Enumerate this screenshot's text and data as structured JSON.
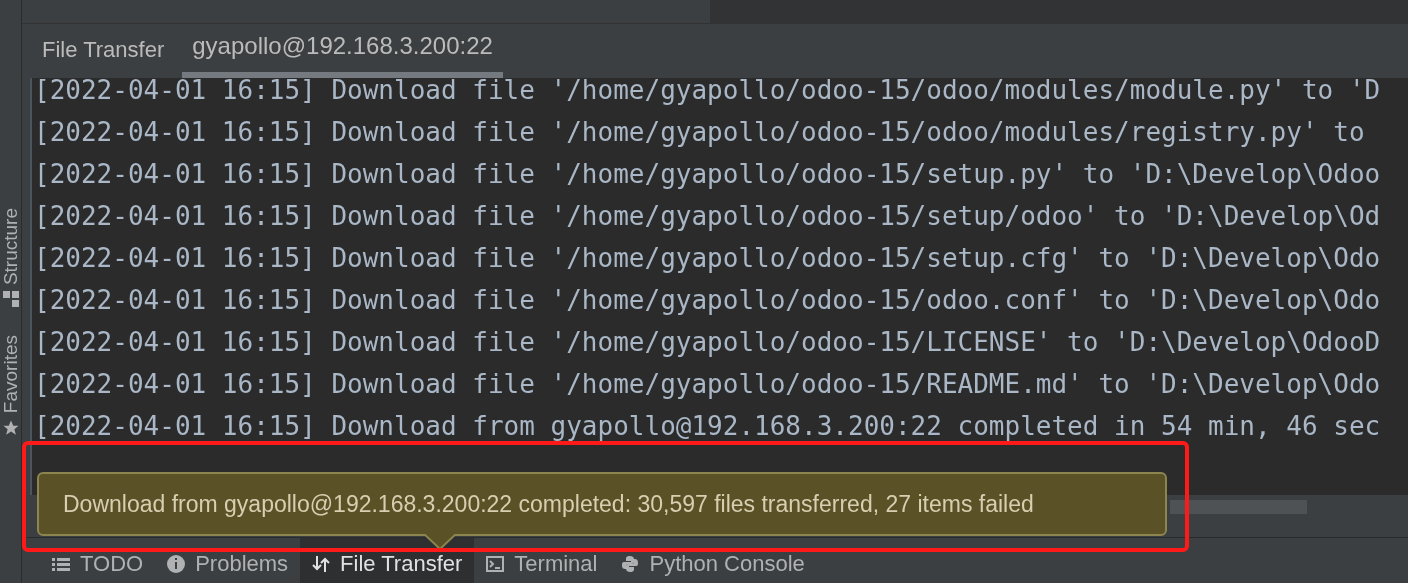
{
  "side_panels": [
    {
      "label": "Structure",
      "kind": "structure"
    },
    {
      "label": "Favorites",
      "kind": "favorites"
    }
  ],
  "tool_window": {
    "title": "File Transfer",
    "tabs": [
      {
        "label": "gyapollo@192.168.3.200:22",
        "selected": true
      }
    ]
  },
  "log_lines": [
    "[2022-04-01 16:15] Download file '/home/gyapollo/odoo-15/odoo/modules/module.py' to 'D",
    "[2022-04-01 16:15] Download file '/home/gyapollo/odoo-15/odoo/modules/registry.py' to",
    "[2022-04-01 16:15] Download file '/home/gyapollo/odoo-15/setup.py' to 'D:\\Develop\\Odoo",
    "[2022-04-01 16:15] Download file '/home/gyapollo/odoo-15/setup/odoo' to 'D:\\Develop\\Od",
    "[2022-04-01 16:15] Download file '/home/gyapollo/odoo-15/setup.cfg' to 'D:\\Develop\\Odo",
    "[2022-04-01 16:15] Download file '/home/gyapollo/odoo-15/odoo.conf' to 'D:\\Develop\\Odo",
    "[2022-04-01 16:15] Download file '/home/gyapollo/odoo-15/LICENSE' to 'D:\\Develop\\OdooD",
    "[2022-04-01 16:15] Download file '/home/gyapollo/odoo-15/README.md' to 'D:\\Develop\\Odo",
    "[2022-04-01 16:15] Download from gyapollo@192.168.3.200:22 completed in 54 min, 46 sec"
  ],
  "notification": {
    "text": "Download from gyapollo@192.168.3.200:22 completed: 30,597 files transferred, 27 items failed"
  },
  "bottom_tabs": [
    {
      "label": "TODO",
      "kind": "todo",
      "selected": false
    },
    {
      "label": "Problems",
      "kind": "problems",
      "selected": false
    },
    {
      "label": "File Transfer",
      "kind": "transfer",
      "selected": true
    },
    {
      "label": "Terminal",
      "kind": "terminal",
      "selected": false
    },
    {
      "label": "Python Console",
      "kind": "python",
      "selected": false
    }
  ]
}
